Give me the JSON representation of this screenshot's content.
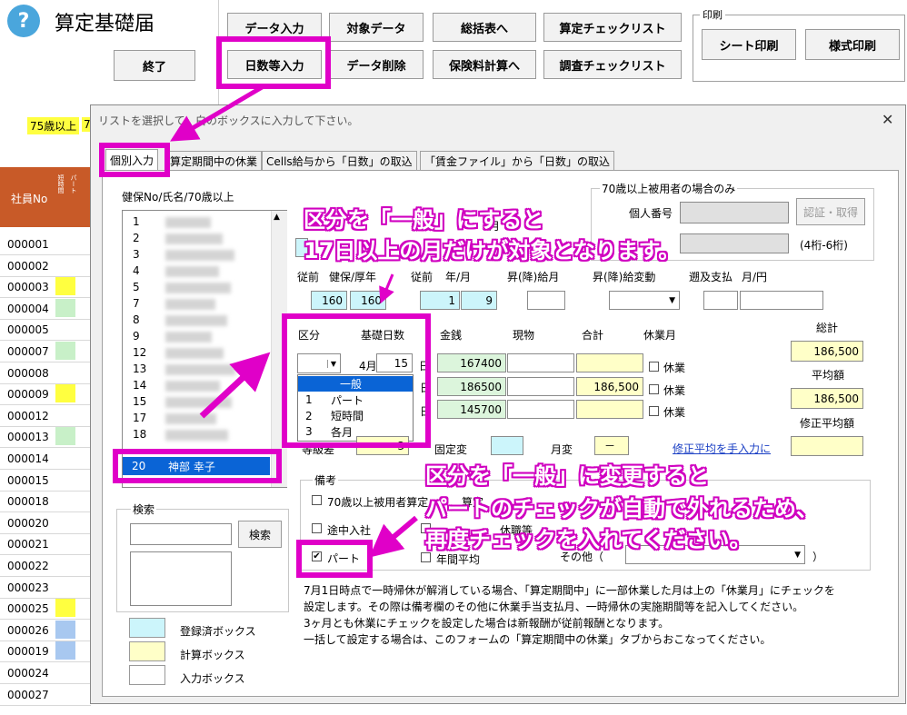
{
  "app": {
    "title": "算定基礎届",
    "help_icon": "question-circle-icon"
  },
  "toolbar": {
    "exit": "終了",
    "data_entry": "データ入力",
    "target_data": "対象データ",
    "summary": "総括表へ",
    "calc_checklist": "算定チェックリスト",
    "days_entry": "日数等入力",
    "data_delete": "データ削除",
    "premium_calc": "保険料計算へ",
    "survey_checklist": "調査チェックリスト",
    "print_group": "印刷",
    "sheet_print": "シート印刷",
    "form_print": "様式印刷"
  },
  "sheet": {
    "age_label": "75歳以上",
    "age_label_partial": "7",
    "col_employee_no": "社員No",
    "col_short": "短時間",
    "col_part": "パート",
    "rows": [
      "000001",
      "000002",
      "000003",
      "000004",
      "000005",
      "000007",
      "000008",
      "000009",
      "000012",
      "000013",
      "000014",
      "000015",
      "000018",
      "000020",
      "000021",
      "000022",
      "000023",
      "000025",
      "000026",
      "000019",
      "000024",
      "000027"
    ]
  },
  "dialog": {
    "instruction": "リストを選択して、白のボックスに入力して下さい。",
    "close_icon": "close-icon",
    "tabs": [
      "個別入力",
      "算定期間中の休業",
      "Cells給与から「日数」の取込",
      "「賃金ファイル」から「日数」の取込"
    ],
    "list_header": "健保No/氏名/70歳以上",
    "list_numbers": [
      "1",
      "2",
      "3",
      "4",
      "5",
      "7",
      "8",
      "9",
      "12",
      "13",
      "14",
      "15",
      "17",
      "18"
    ],
    "selected": {
      "num": "20",
      "name": "神部 幸子"
    },
    "search_group": "検索",
    "search_button": "検索",
    "legend": {
      "registered": "登録済ボックス",
      "calc": "計算ボックス",
      "input": "入力ボックス"
    },
    "over70_group": "70歳以上被用者の場合のみ",
    "personal_no_label": "個人番号",
    "auth_button": "認証・取得",
    "digits_note": "(4桁-6桁)",
    "name_label_partial": "名",
    "month_label_partial": "月",
    "prev_label": "従前",
    "kenpo_label": "健保/厚年",
    "prev_label2": "従前",
    "ym_label": "年/月",
    "raise_salary_label": "昇(降)給月",
    "raise_change_label": "昇(降)給変動",
    "retro_label": "遡及支払",
    "month_yen_label": "月/円",
    "kenpo_value": "160",
    "kounen_value": "160",
    "prev_year": "1",
    "prev_month": "9",
    "category_label": "区分",
    "base_days_label": "基礎日数",
    "money_label": "金銭",
    "goods_label": "現物",
    "sum_label": "合計",
    "leave_month_label": "休業月",
    "total_label": "総計",
    "total_value": "186,500",
    "avg_label": "平均額",
    "avg_value": "186,500",
    "corr_avg_label": "修正平均額",
    "month_apr": "4月",
    "days_apr": "15",
    "day_unit": "日",
    "money": [
      "167400",
      "186500",
      "145700"
    ],
    "sums": [
      "",
      "186,500",
      ""
    ],
    "leave_label": "休業",
    "dropdown_options": [
      {
        "num": "",
        "label": "一般"
      },
      {
        "num": "1",
        "label": "パート"
      },
      {
        "num": "2",
        "label": "短時間"
      },
      {
        "num": "3",
        "label": "各月"
      }
    ],
    "grade_diff_label": "等級差",
    "grade_diff_value": "3",
    "fixed_change_label": "固定変",
    "month_change_label": "月変",
    "month_change_value": "－",
    "manual_avg_link": "修正平均を手入力に",
    "remarks_group": "備考",
    "over70_check": "70歳以上被用者算定",
    "midjoin_check": "途中入社",
    "part_check": "パート",
    "annual_avg_check": "年間平均",
    "other_label": "その他（",
    "other_close": "）",
    "remark_partial1": "算定",
    "remark_partial2": "休職等",
    "note_lines": [
      "7月1日時点で一時帰休が解消している場合、「算定期間中」に一部休業した月は上の「休業月」にチェックを",
      "設定します。その際は備考欄のその他に休業手当支払月、一時帰休の実施期間等を記入してください。",
      "3ヶ月とも休業にチェックを設定した場合は新報酬が従前報酬となります。",
      "一括して設定する場合は、このフォームの「算定期間中の休業」タブからおこなってください。"
    ]
  },
  "annotations": {
    "top1": "区分を「一般」にすると",
    "top2": "17日以上の月だけが対象となります。",
    "bottom1": "区分を「一般」に変更すると",
    "bottom2": "パートのチェックが自動で外れるため、",
    "bottom3": "再度チェックを入れてください。"
  },
  "colors": {
    "highlight": "#e000c8",
    "cyan_box": "#ccf5fb",
    "yellow_box": "#ffffc8",
    "green_box": "#dcf5dc",
    "select_blue": "#0a64d6"
  }
}
